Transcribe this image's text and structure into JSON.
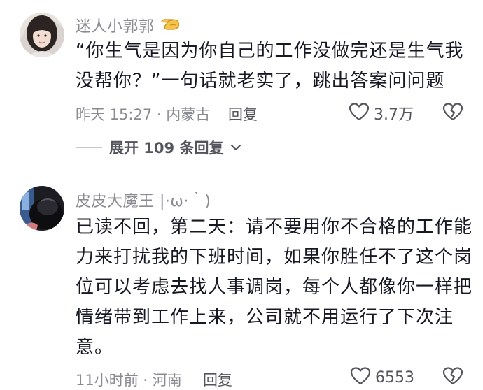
{
  "comments": [
    {
      "username": "迷人小郭郭",
      "emoji_name": "pointing-hand-emoji",
      "text_lines": [
        "“你生气是因为你自己的工作没做完还是生气我",
        "没帮你？”一句话就老实了，跳出答案问问题"
      ],
      "time_location": "昨天 15:27 · 内蒙古",
      "reply_label": "回复",
      "like_count": "3.7万",
      "like_icon": "heart-outline-icon",
      "dislike_icon": "broken-heart-icon",
      "expand_label": "展开 109 条回复"
    },
    {
      "username": "皮皮大魔王 |·ω·｀)",
      "text_lines": [
        "已读不回，第二天：请不要用你不合格的工作能",
        "力来打扰我的下班时间，如果你胜任不了这个岗",
        "位可以考虑去找人事调岗，每个人都像你一样把",
        "情绪带到工作上来，公司就不用运行了下次注",
        "意。"
      ],
      "time_location": "11小时前 · 河南",
      "reply_label": "回复",
      "like_count": "6553",
      "like_icon": "heart-outline-icon",
      "dislike_icon": "broken-heart-icon"
    }
  ],
  "colors": {
    "primary_text": "#161823",
    "secondary_text": "#8a8b91",
    "action_text": "#54555c"
  }
}
